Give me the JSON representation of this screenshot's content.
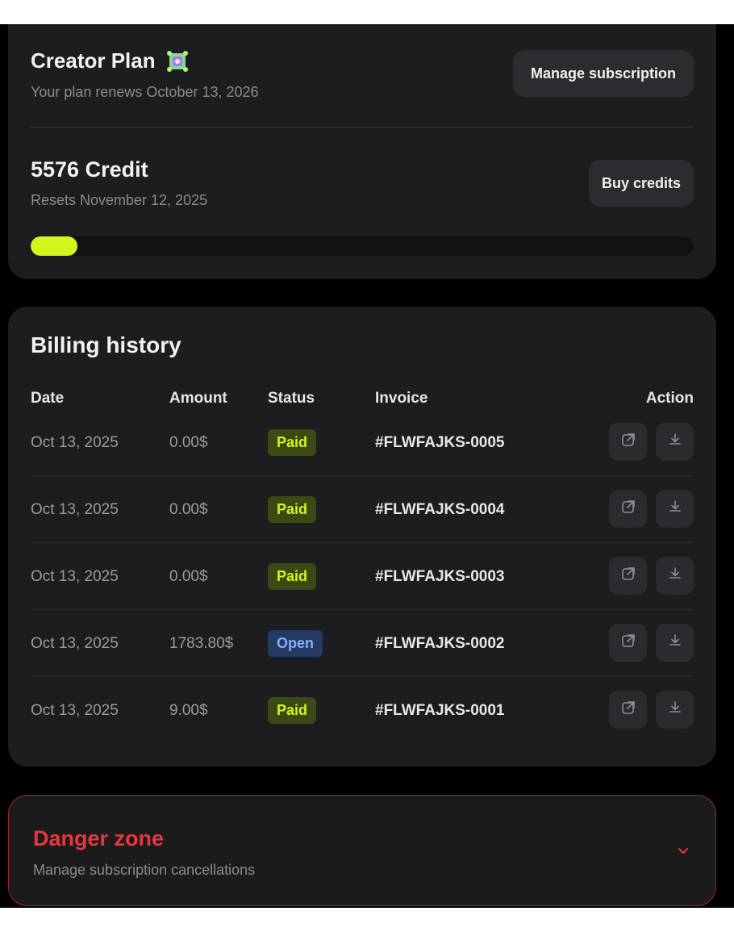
{
  "plan": {
    "title": "Creator Plan",
    "badge_icon": "plan-badge-icon",
    "renew_text": "Your plan renews October 13, 2026",
    "manage_button": "Manage subscription"
  },
  "credits": {
    "amount_text": "5576 Credit",
    "reset_text": "Resets November 12, 2025",
    "buy_button": "Buy credits",
    "usage_fraction": 0.07,
    "accent_color": "#d4f51c"
  },
  "billing": {
    "title": "Billing history",
    "headers": {
      "date": "Date",
      "amount": "Amount",
      "status": "Status",
      "invoice": "Invoice",
      "action": "Action"
    },
    "rows": [
      {
        "date": "Oct 13, 2025",
        "amount": "0.00$",
        "status": "Paid",
        "invoice": "#FLWFAJKS-0005"
      },
      {
        "date": "Oct 13, 2025",
        "amount": "0.00$",
        "status": "Paid",
        "invoice": "#FLWFAJKS-0004"
      },
      {
        "date": "Oct 13, 2025",
        "amount": "0.00$",
        "status": "Paid",
        "invoice": "#FLWFAJKS-0003"
      },
      {
        "date": "Oct 13, 2025",
        "amount": "1783.80$",
        "status": "Open",
        "invoice": "#FLWFAJKS-0002"
      },
      {
        "date": "Oct 13, 2025",
        "amount": "9.00$",
        "status": "Paid",
        "invoice": "#FLWFAJKS-0001"
      }
    ],
    "action_icons": [
      "external-link-icon",
      "download-icon"
    ]
  },
  "danger": {
    "title": "Danger zone",
    "subtitle": "Manage subscription cancellations",
    "color": "#e5373d",
    "chevron_icon": "chevron-down-icon"
  }
}
